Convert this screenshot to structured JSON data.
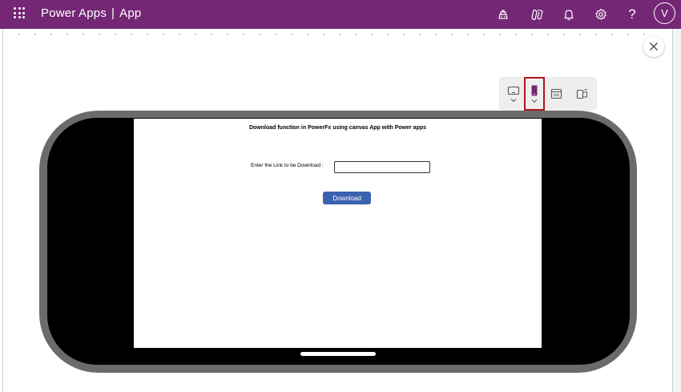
{
  "header": {
    "app_name": "Power Apps",
    "separator": "|",
    "environment": "App",
    "icons": [
      "app-launcher-icon",
      "environment-icon",
      "copilot-icon",
      "notifications-icon",
      "settings-icon",
      "help-icon"
    ],
    "help_glyph": "?",
    "avatar_initial": "V",
    "bar_color": "#742774"
  },
  "preview": {
    "close_icon": "close-icon",
    "device_toolbar": {
      "items": [
        "tablet-icon",
        "phone-icon",
        "web-icon",
        "fit-to-screen-icon"
      ],
      "selected": "phone-icon",
      "selected_border_color": "#b3121d"
    }
  },
  "app": {
    "title": "Download function in PowerFx using canvas App with Power apps",
    "link_label": "Enter the Link to be Download :",
    "link_value": "",
    "download_button_label": "Download",
    "button_color": "#3a62b0"
  }
}
